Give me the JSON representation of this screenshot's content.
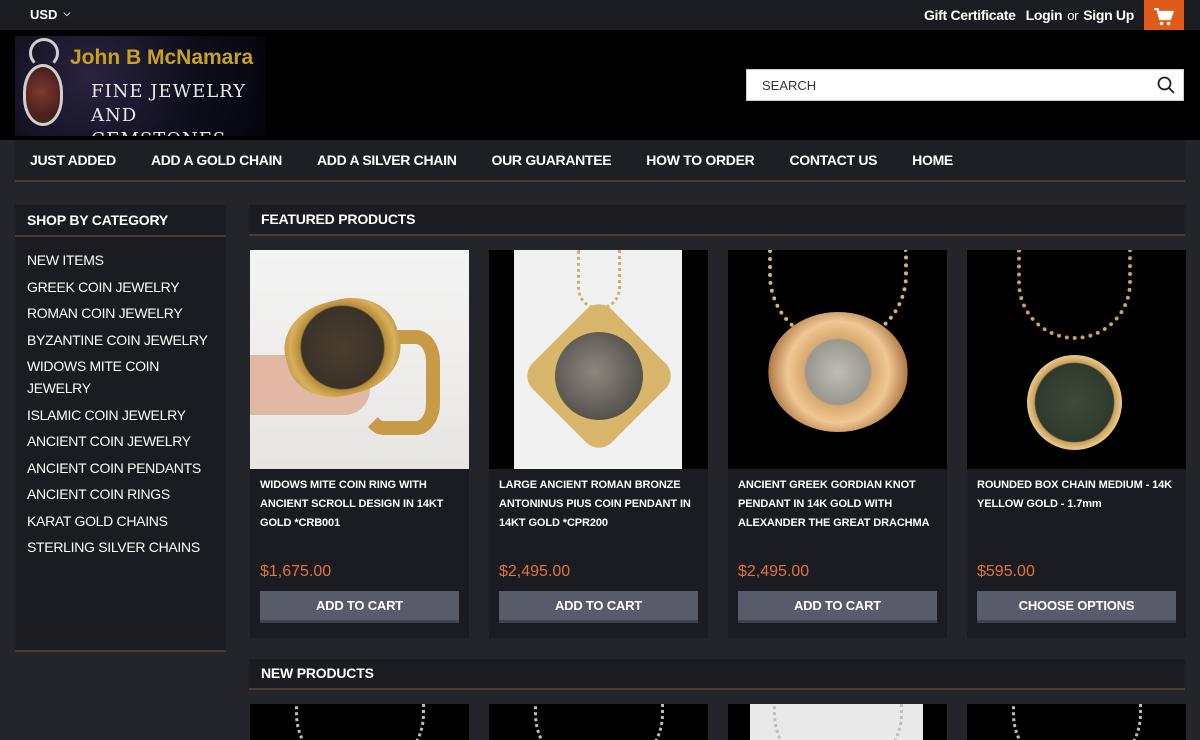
{
  "topbar": {
    "currency": "USD",
    "gift": "Gift Certificate",
    "login": "Login",
    "or": "or",
    "signup": "Sign Up"
  },
  "logo": {
    "brand": "John B McNamara",
    "line1": "FINE JEWELRY",
    "line2": "AND GEMSTONES"
  },
  "search": {
    "placeholder": "SEARCH"
  },
  "nav": [
    "JUST ADDED",
    "ADD A GOLD CHAIN",
    "ADD A SILVER CHAIN",
    "OUR GUARANTEE",
    "HOW TO ORDER",
    "CONTACT US",
    "HOME"
  ],
  "sidebar": {
    "title": "SHOP BY CATEGORY",
    "items": [
      "NEW ITEMS",
      "GREEK COIN JEWELRY",
      "ROMAN COIN JEWELRY",
      "BYZANTINE COIN JEWELRY",
      "WIDOWS MITE COIN JEWELRY",
      "ISLAMIC COIN JEWELRY",
      "ANCIENT COIN JEWELRY",
      "ANCIENT COIN PENDANTS",
      "ANCIENT COIN RINGS",
      "KARAT GOLD CHAINS",
      "STERLING SILVER CHAINS"
    ]
  },
  "featured": {
    "title": "FEATURED PRODUCTS",
    "products": [
      {
        "title": "WIDOWS MITE COIN RING WITH ANCIENT SCROLL DESIGN IN 14KT GOLD *CRB001",
        "price": "$1,675.00",
        "button": "ADD TO CART"
      },
      {
        "title": "LARGE ANCIENT ROMAN BRONZE ANTONINUS PIUS COIN PENDANT IN 14KT GOLD *CPR200",
        "price": "$2,495.00",
        "button": "ADD TO CART"
      },
      {
        "title": "ANCIENT GREEK GORDIAN KNOT PENDANT IN 14K GOLD WITH ALEXANDER THE GREAT DRACHMA",
        "price": "$2,495.00",
        "button": "ADD TO CART"
      },
      {
        "title": "ROUNDED BOX CHAIN MEDIUM - 14K YELLOW GOLD - 1.7mm",
        "price": "$595.00",
        "button": "CHOOSE OPTIONS"
      }
    ]
  },
  "new_products": {
    "title": "NEW PRODUCTS"
  },
  "colors": {
    "accent": "#e05a1a",
    "price": "#e2733a",
    "button": "#585b6a"
  }
}
